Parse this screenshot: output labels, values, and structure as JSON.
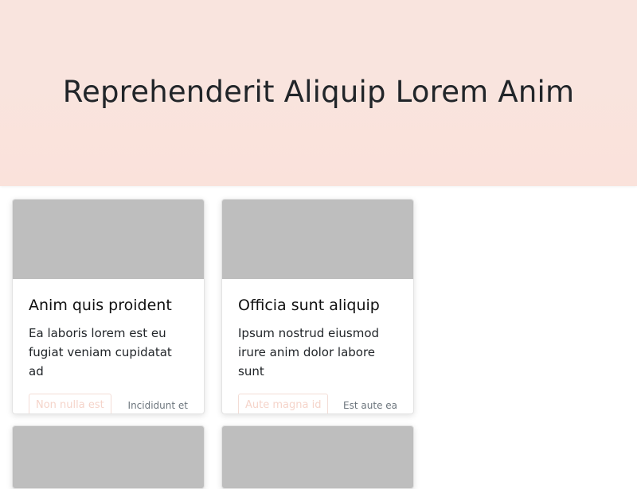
{
  "hero": {
    "title": "Reprehenderit Aliquip Lorem Anim"
  },
  "cards": [
    {
      "title": "Anim quis proident",
      "text": "Ea laboris lorem est eu fugiat veniam cupidatat ad",
      "button": "Non nulla est",
      "meta": "Incididunt et"
    },
    {
      "title": "Officia sunt aliquip",
      "text": "Ipsum nostrud eiusmod irure anim dolor labore sunt",
      "button": "Aute magna id",
      "meta": "Est aute ea"
    }
  ]
}
